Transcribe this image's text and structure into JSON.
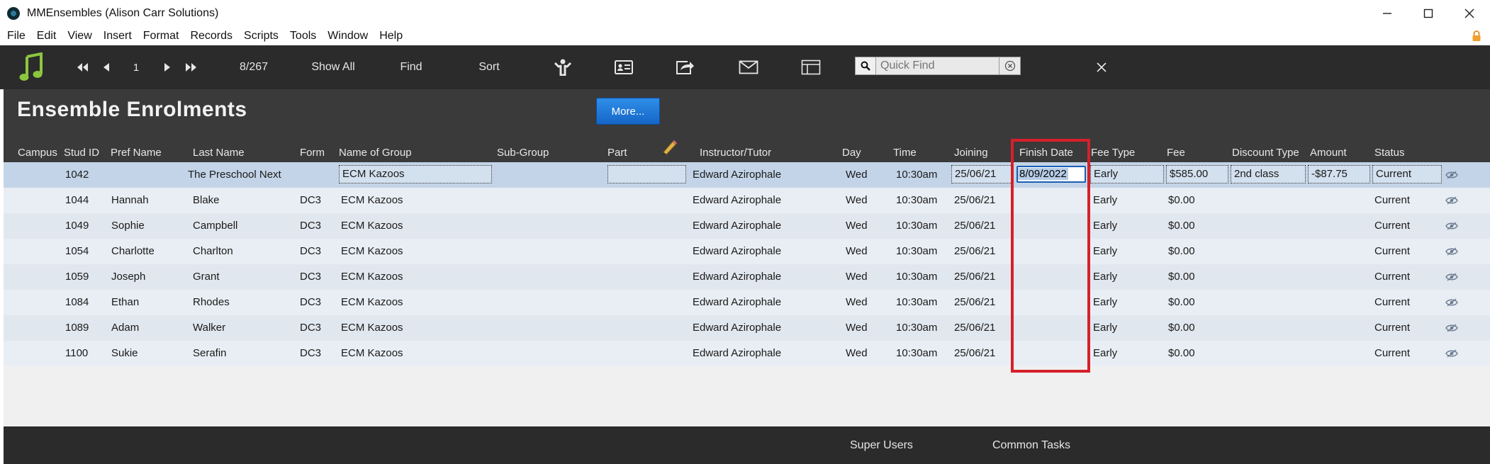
{
  "window": {
    "title": "MMEnsembles (Alison Carr Solutions)",
    "controls": [
      "minimize",
      "maximize",
      "close"
    ]
  },
  "menu": [
    "File",
    "Edit",
    "View",
    "Insert",
    "Format",
    "Records",
    "Scripts",
    "Tools",
    "Window",
    "Help"
  ],
  "toolbar": {
    "record_number": "1",
    "record_count": "8/267",
    "show_all": "Show All",
    "find": "Find",
    "sort": "Sort",
    "quick_find_placeholder": "Quick Find"
  },
  "header": {
    "title": "Ensemble Enrolments",
    "more_button": "More..."
  },
  "columns": {
    "campus": "Campus",
    "stud_id": "Stud ID",
    "pref_name": "Pref Name",
    "last_name": "Last Name",
    "form": "Form",
    "group": "Name of Group",
    "sub_group": "Sub-Group",
    "part": "Part",
    "instructor": "Instructor/Tutor",
    "day": "Day",
    "time": "Time",
    "joining": "Joining",
    "finish_date": "Finish Date",
    "fee_type": "Fee Type",
    "fee": "Fee",
    "discount_type": "Discount Type",
    "amount": "Amount",
    "status": "Status"
  },
  "rows": [
    {
      "stud_id": "1042",
      "pref_name": "",
      "last_name": "The Preschool Next",
      "form": "",
      "group": "ECM Kazoos",
      "instructor": "Edward Azirophale",
      "day": "Wed",
      "time": "10:30am",
      "joining": "25/06/21",
      "finish_date": "8/09/2022",
      "fee_type": "Early",
      "fee": "$585.00",
      "discount_type": "2nd class",
      "amount": "-$87.75",
      "status": "Current"
    },
    {
      "stud_id": "1044",
      "pref_name": "Hannah",
      "last_name": "Blake",
      "form": "DC3",
      "group": "ECM Kazoos",
      "instructor": "Edward Azirophale",
      "day": "Wed",
      "time": "10:30am",
      "joining": "25/06/21",
      "finish_date": "",
      "fee_type": "Early",
      "fee": "$0.00",
      "discount_type": "",
      "amount": "",
      "status": "Current"
    },
    {
      "stud_id": "1049",
      "pref_name": "Sophie",
      "last_name": "Campbell",
      "form": "DC3",
      "group": "ECM Kazoos",
      "instructor": "Edward Azirophale",
      "day": "Wed",
      "time": "10:30am",
      "joining": "25/06/21",
      "finish_date": "",
      "fee_type": "Early",
      "fee": "$0.00",
      "discount_type": "",
      "amount": "",
      "status": "Current"
    },
    {
      "stud_id": "1054",
      "pref_name": "Charlotte",
      "last_name": "Charlton",
      "form": "DC3",
      "group": "ECM Kazoos",
      "instructor": "Edward Azirophale",
      "day": "Wed",
      "time": "10:30am",
      "joining": "25/06/21",
      "finish_date": "",
      "fee_type": "Early",
      "fee": "$0.00",
      "discount_type": "",
      "amount": "",
      "status": "Current"
    },
    {
      "stud_id": "1059",
      "pref_name": "Joseph",
      "last_name": "Grant",
      "form": "DC3",
      "group": "ECM Kazoos",
      "instructor": "Edward Azirophale",
      "day": "Wed",
      "time": "10:30am",
      "joining": "25/06/21",
      "finish_date": "",
      "fee_type": "Early",
      "fee": "$0.00",
      "discount_type": "",
      "amount": "",
      "status": "Current"
    },
    {
      "stud_id": "1084",
      "pref_name": "Ethan",
      "last_name": "Rhodes",
      "form": "DC3",
      "group": "ECM Kazoos",
      "instructor": "Edward Azirophale",
      "day": "Wed",
      "time": "10:30am",
      "joining": "25/06/21",
      "finish_date": "",
      "fee_type": "Early",
      "fee": "$0.00",
      "discount_type": "",
      "amount": "",
      "status": "Current"
    },
    {
      "stud_id": "1089",
      "pref_name": "Adam",
      "last_name": "Walker",
      "form": "DC3",
      "group": "ECM Kazoos",
      "instructor": "Edward Azirophale",
      "day": "Wed",
      "time": "10:30am",
      "joining": "25/06/21",
      "finish_date": "",
      "fee_type": "Early",
      "fee": "$0.00",
      "discount_type": "",
      "amount": "",
      "status": "Current"
    },
    {
      "stud_id": "1100",
      "pref_name": "Sukie",
      "last_name": "Serafin",
      "form": "DC3",
      "group": "ECM Kazoos",
      "instructor": "Edward Azirophale",
      "day": "Wed",
      "time": "10:30am",
      "joining": "25/06/21",
      "finish_date": "",
      "fee_type": "Early",
      "fee": "$0.00",
      "discount_type": "",
      "amount": "",
      "status": "Current"
    }
  ],
  "footer": {
    "super_users": "Super Users",
    "common_tasks": "Common Tasks"
  },
  "colors": {
    "toolbar_bg": "#2b2b2b",
    "header_bg": "#3a3a3a",
    "selected_row": "#c3d4e8",
    "accent_blue": "#1566c7",
    "highlight_red": "#d6202a",
    "logo_green": "#8cc63f"
  }
}
